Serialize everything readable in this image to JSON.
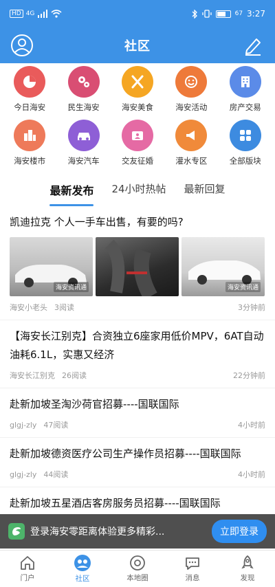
{
  "status": {
    "network": "HD",
    "signal": "4G",
    "battery": "67",
    "time": "3:27"
  },
  "header": {
    "title": "社区",
    "left_icon": "profile-icon",
    "right_icon": "edit-icon"
  },
  "categories": [
    {
      "label": "今日海安",
      "color": "#e95b5b"
    },
    {
      "label": "民生海安",
      "color": "#d94e73"
    },
    {
      "label": "海安美食",
      "color": "#f5a623"
    },
    {
      "label": "海安活动",
      "color": "#ee7a3a"
    },
    {
      "label": "房产交易",
      "color": "#5b8be8"
    },
    {
      "label": "海安楼市",
      "color": "#ee7a5a"
    },
    {
      "label": "海安汽车",
      "color": "#8e5fd6"
    },
    {
      "label": "交友征婚",
      "color": "#e56aa4"
    },
    {
      "label": "灌水专区",
      "color": "#f08a3a"
    },
    {
      "label": "全部版块",
      "color": "#3d8be0"
    }
  ],
  "tabs": [
    "最新发布",
    "24小时热帖",
    "最新回复"
  ],
  "posts": [
    {
      "title": "凯迪拉克 个人一手车出售，有要的吗?",
      "author": "海安小老头",
      "reads": "3阅读",
      "time": "3分钟前",
      "watermark": "海安资讯通"
    },
    {
      "title": "【海安长江别克】合资独立6座家用低价MPV，6AT自动油耗6.1L，实惠又经济",
      "author": "海安长江别克",
      "reads": "26阅读",
      "time": "22分钟前"
    },
    {
      "title": "赴新加坡圣淘沙荷官招募----国联国际",
      "author": "glgj-zly",
      "reads": "47阅读",
      "time": "4小时前"
    },
    {
      "title": "赴新加坡德资医疗公司生产操作员招募----国联国际",
      "author": "glgj-zly",
      "reads": "44阅读",
      "time": "4小时前"
    },
    {
      "title": "赴新加坡五星酒店客房服务员招募----国联国际"
    }
  ],
  "banner": {
    "text": "登录海安零距离体验更多精彩...",
    "button": "立即登录"
  },
  "bottom_nav": [
    {
      "label": "门户",
      "icon": "home-icon"
    },
    {
      "label": "社区",
      "icon": "community-icon",
      "active": true
    },
    {
      "label": "本地圈",
      "icon": "camera-icon"
    },
    {
      "label": "消息",
      "icon": "message-icon"
    },
    {
      "label": "发现",
      "icon": "rocket-icon"
    }
  ],
  "colors": {
    "primary": "#3d92e6",
    "banner_bg": "#1e1e1e"
  }
}
